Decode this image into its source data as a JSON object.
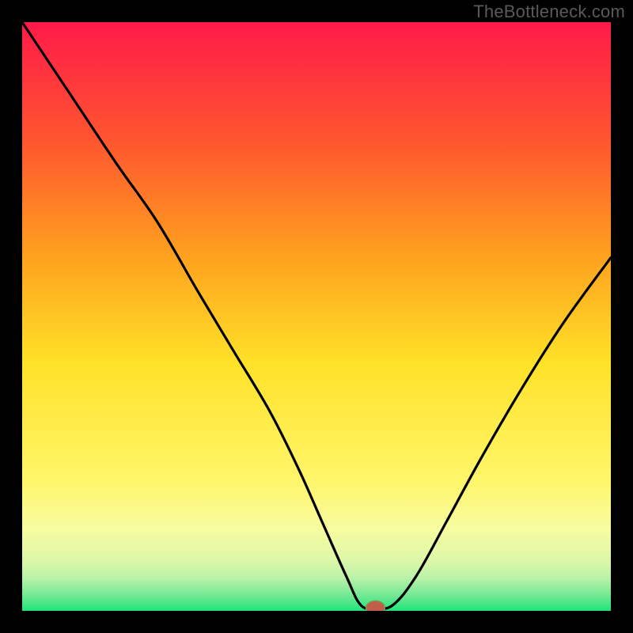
{
  "watermark": {
    "text": "TheBottleneck.com"
  },
  "colors": {
    "page_bg": "#000000",
    "watermark": "#5a5a5a",
    "curve": "#000000",
    "marker_fill": "#c15d4b",
    "marker_stroke": "#7d9a4f",
    "gradient_top": "#ff1a49",
    "gradient_mid_upper": "#ff8a2a",
    "gradient_mid": "#ffe228",
    "gradient_lower": "#f8fca0",
    "gradient_band": "#b8f2a8",
    "gradient_bottom": "#20e47a"
  },
  "chart_data": {
    "type": "line",
    "title": "",
    "xlabel": "",
    "ylabel": "",
    "xlim": [
      0,
      100
    ],
    "ylim": [
      0,
      100
    ],
    "grid": false,
    "legend": false,
    "series": [
      {
        "name": "bottleneck-curve",
        "x": [
          0,
          8,
          16,
          23,
          30,
          36,
          42,
          47,
          51,
          55,
          57.5,
          60,
          63,
          67,
          72,
          78,
          85,
          92,
          100
        ],
        "y": [
          100,
          88,
          76,
          66,
          54,
          44,
          34,
          24,
          15,
          6,
          1,
          0.5,
          1,
          6,
          15,
          26,
          38,
          49,
          60
        ]
      }
    ],
    "marker": {
      "x": 60,
      "y": 0.5,
      "rx": 1.6,
      "ry": 1.2
    },
    "background_gradient_stops": [
      {
        "offset": 0.0,
        "color": "#ff1a49"
      },
      {
        "offset": 0.2,
        "color": "#ff552f"
      },
      {
        "offset": 0.4,
        "color": "#ffa21e"
      },
      {
        "offset": 0.58,
        "color": "#ffe228"
      },
      {
        "offset": 0.78,
        "color": "#fff66b"
      },
      {
        "offset": 0.86,
        "color": "#f8fca0"
      },
      {
        "offset": 0.915,
        "color": "#dcf7a8"
      },
      {
        "offset": 0.945,
        "color": "#b8f2a8"
      },
      {
        "offset": 0.975,
        "color": "#6fe893"
      },
      {
        "offset": 1.0,
        "color": "#20e47a"
      }
    ]
  }
}
